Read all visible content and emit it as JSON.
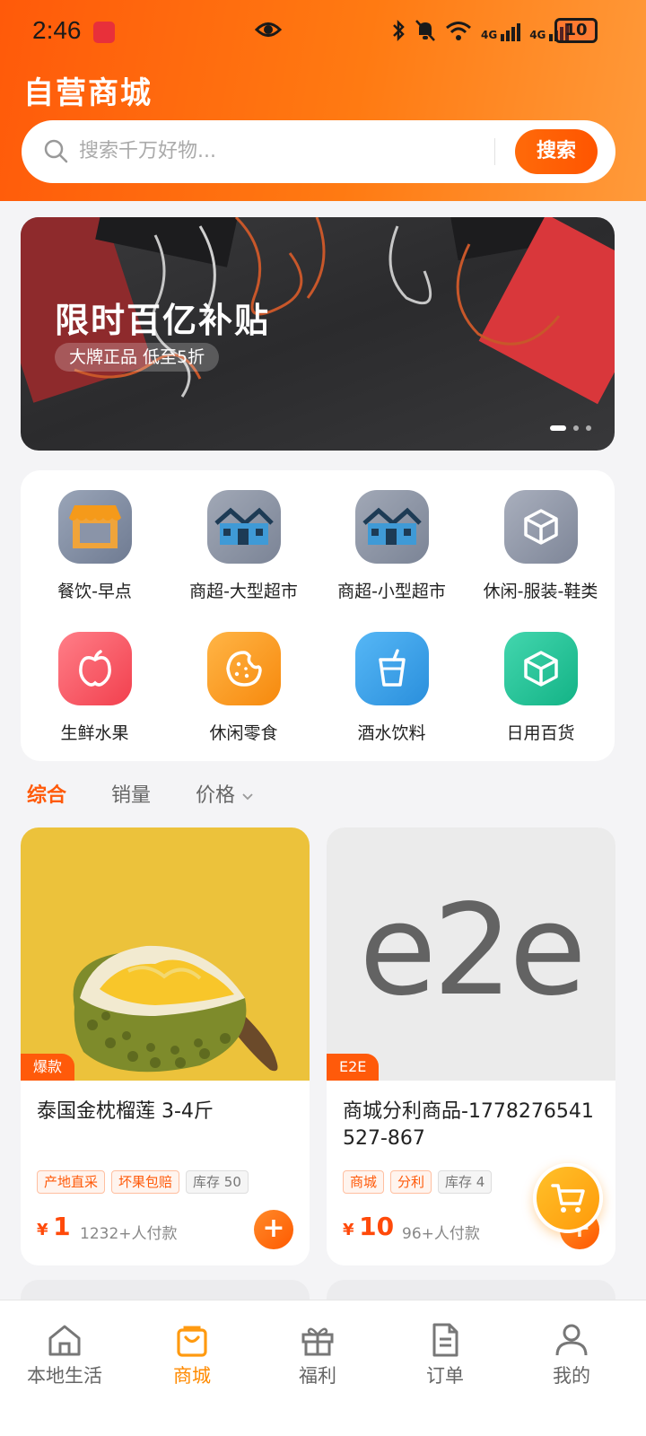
{
  "status_bar": {
    "time": "2:46",
    "battery": "10",
    "signal_1": "4G",
    "signal_2": "4G"
  },
  "header": {
    "title": "自营商城",
    "search": {
      "placeholder": "搜索千万好物...",
      "button": "搜索"
    }
  },
  "banner": {
    "title": "限时百亿补贴",
    "subtitle": "大牌正品 低至5折",
    "dots": 3,
    "active_dot": 1
  },
  "categories": [
    {
      "label": "餐饮-早点",
      "icon": "storefront-icon"
    },
    {
      "label": "商超-大型超市",
      "icon": "houses-icon"
    },
    {
      "label": "商超-小型超市",
      "icon": "houses-icon"
    },
    {
      "label": "休闲-服装-鞋类",
      "icon": "box-icon"
    },
    {
      "label": "生鲜水果",
      "icon": "apple-icon"
    },
    {
      "label": "休闲零食",
      "icon": "cookie-icon"
    },
    {
      "label": "酒水饮料",
      "icon": "cup-icon"
    },
    {
      "label": "日用百货",
      "icon": "box-icon"
    }
  ],
  "sort": {
    "tabs": [
      "综合",
      "销量",
      "价格"
    ],
    "active": "综合"
  },
  "products": [
    {
      "tag": "爆款",
      "name": "泰国金枕榴莲 3-4斤",
      "badges": [
        "产地直采",
        "坏果包赔",
        "库存 50"
      ],
      "currency": "¥",
      "price": "1",
      "sold": "1232+人付款"
    },
    {
      "tag": "E2E",
      "image_text": "e2e",
      "name": "商城分利商品-1778276541527-867",
      "badges": [
        "商城",
        "分利",
        "库存 4"
      ],
      "currency": "¥",
      "price": "10",
      "sold": "96+人付款"
    }
  ],
  "tabbar": [
    {
      "label": "本地生活",
      "icon": "home-icon"
    },
    {
      "label": "商城",
      "icon": "shopping-bag-icon"
    },
    {
      "label": "福利",
      "icon": "gift-icon"
    },
    {
      "label": "订单",
      "icon": "document-icon"
    },
    {
      "label": "我的",
      "icon": "user-icon"
    }
  ],
  "tabbar_active": "商城",
  "colors": {
    "brand": "#ff5a0a",
    "accent": "#ff8a00",
    "price": "#ff4a0a"
  }
}
